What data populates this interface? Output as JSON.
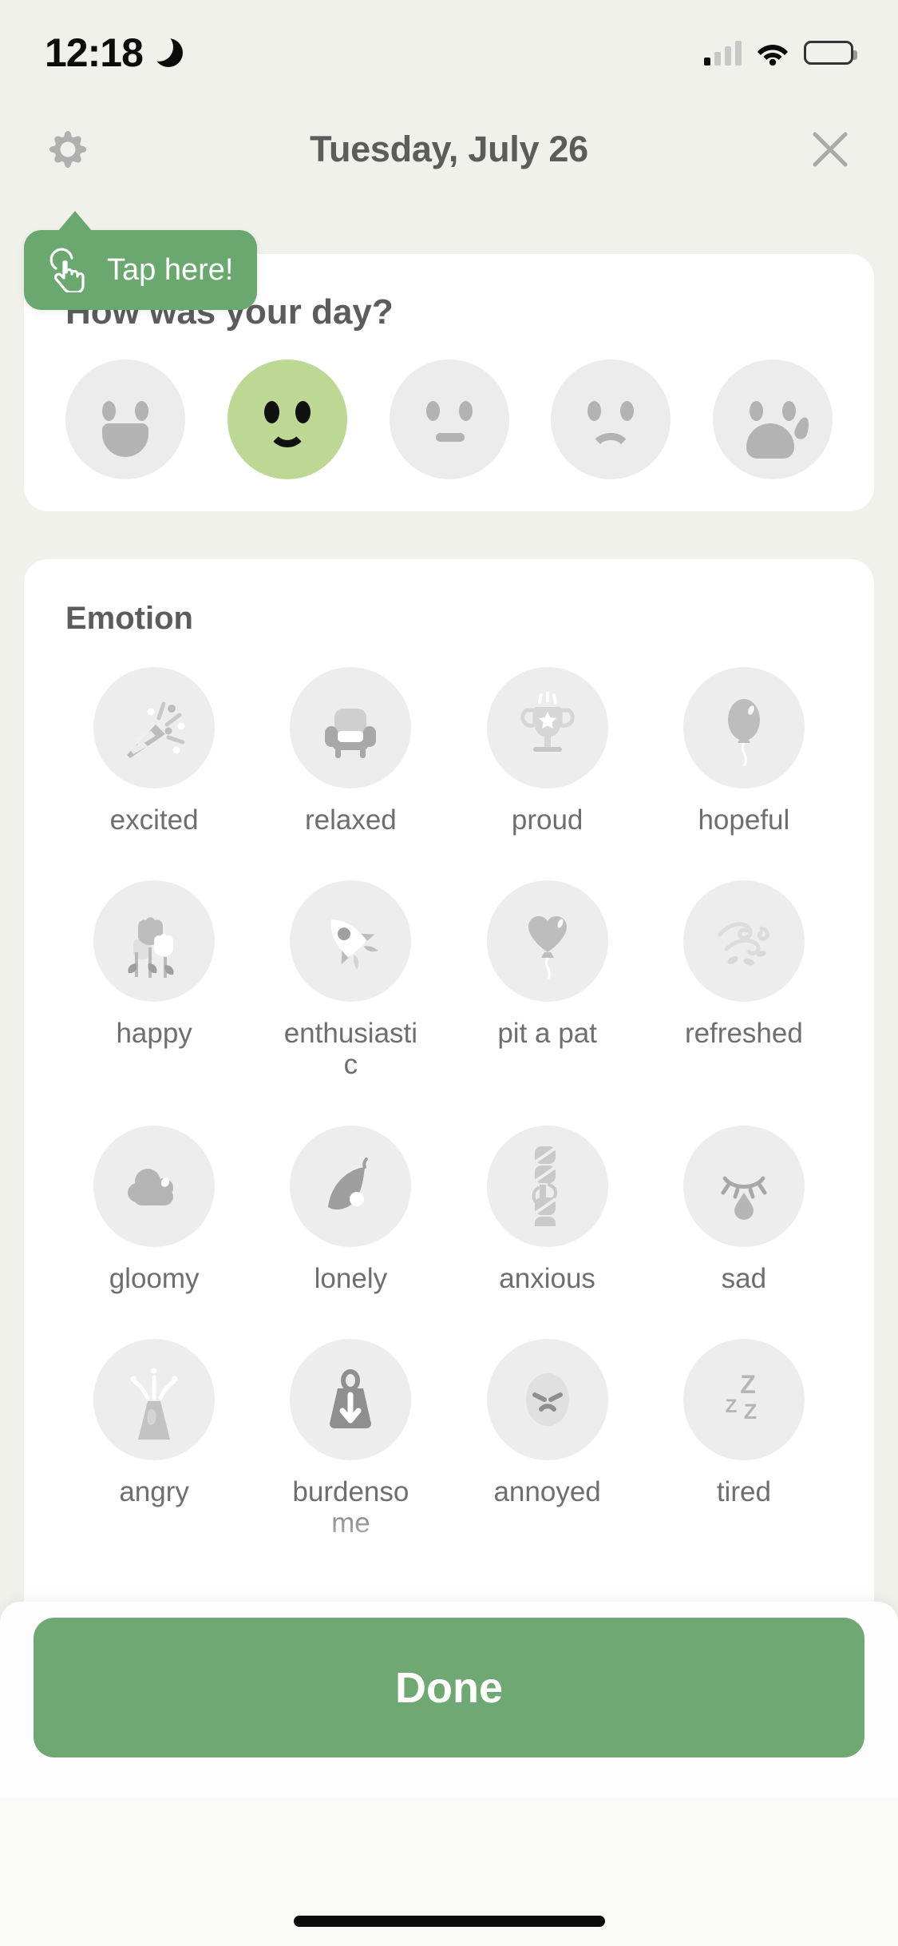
{
  "status_bar": {
    "time": "12:18",
    "dnd_icon": "moon-icon",
    "signal_icon": "cellular-signal-icon",
    "wifi_icon": "wifi-icon",
    "battery_icon": "battery-icon"
  },
  "header": {
    "settings_icon": "gear-icon",
    "title": "Tuesday, July 26",
    "close_icon": "close-x-icon"
  },
  "tooltip": {
    "label": "Tap here!",
    "icon": "tap-hand-icon",
    "color": "#6aa86f"
  },
  "mood_section": {
    "heading": "How was your day?",
    "selected_index": 1,
    "faces": [
      {
        "name": "very-happy-face",
        "mood": "very happy"
      },
      {
        "name": "happy-face",
        "mood": "happy"
      },
      {
        "name": "neutral-face",
        "mood": "neutral"
      },
      {
        "name": "sad-face",
        "mood": "sad"
      },
      {
        "name": "crying-face",
        "mood": "crying"
      }
    ],
    "selected_color": "#bcd894",
    "unselected_color": "#ececec"
  },
  "emotion_section": {
    "heading": "Emotion",
    "items": [
      {
        "label": "excited",
        "icon": "party-popper-icon"
      },
      {
        "label": "relaxed",
        "icon": "armchair-icon"
      },
      {
        "label": "proud",
        "icon": "trophy-icon"
      },
      {
        "label": "hopeful",
        "icon": "balloon-icon"
      },
      {
        "label": "happy",
        "icon": "tulips-icon"
      },
      {
        "label": "enthusiastic",
        "icon": "rocket-icon"
      },
      {
        "label": "pit a pat",
        "icon": "heart-balloon-icon"
      },
      {
        "label": "refreshed",
        "icon": "breeze-icon"
      },
      {
        "label": "gloomy",
        "icon": "cloud-icon"
      },
      {
        "label": "lonely",
        "icon": "leaf-icon"
      },
      {
        "label": "anxious",
        "icon": "twisted-rope-icon"
      },
      {
        "label": "sad",
        "icon": "teardrop-eye-icon"
      },
      {
        "label": "angry",
        "icon": "volcano-icon"
      },
      {
        "label": "burdensome",
        "icon": "weight-icon"
      },
      {
        "label": "annoyed",
        "icon": "annoyed-face-icon"
      },
      {
        "label": "tired",
        "icon": "zzz-icon"
      }
    ]
  },
  "footer": {
    "done_label": "Done",
    "done_color": "#6fa873",
    "home_indicator": "home-indicator"
  },
  "theme": {
    "background": "#f0f1ea",
    "card_background": "#ffffff",
    "text_primary": "#5c5c5c",
    "text_secondary": "#6e6e6e",
    "icon_gray": "#b3b3b3",
    "bubble_gray": "#ededed"
  }
}
